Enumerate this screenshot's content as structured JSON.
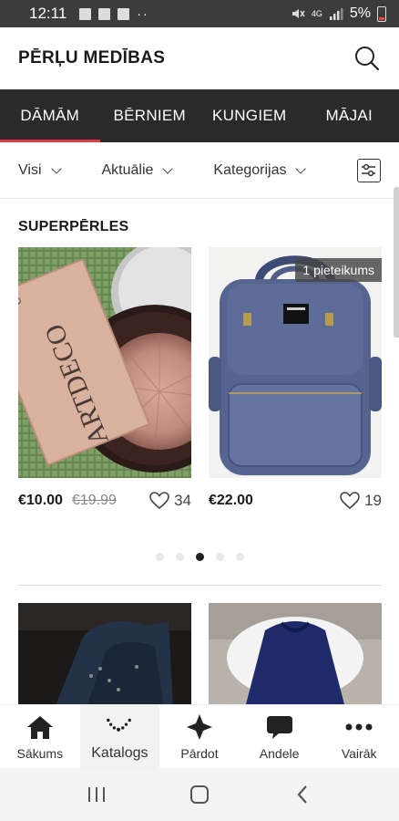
{
  "status_bar": {
    "time": "12:11",
    "dots": "··",
    "network": "4G",
    "battery": "5%"
  },
  "header": {
    "title": "PĒRĻU MEDĪBAS"
  },
  "category_tabs": [
    {
      "label": "DĀMĀM",
      "active": true
    },
    {
      "label": "BĒRNIEM",
      "active": false
    },
    {
      "label": "KUNGIEM",
      "active": false
    },
    {
      "label": "MĀJAI",
      "active": false
    }
  ],
  "filters": {
    "all": "Visi",
    "current": "Aktuālie",
    "categories": "Kategorijas"
  },
  "section": {
    "title": "SUPERPĒRLES"
  },
  "products": [
    {
      "price": "€10.00",
      "old_price": "€19.99",
      "likes": "34",
      "brand_text": "ARTDECO",
      "badge": ""
    },
    {
      "price": "€22.00",
      "old_price": "",
      "likes": "19",
      "badge": "1 pieteikums"
    }
  ],
  "pagination": {
    "total": 5,
    "active_index": 2
  },
  "bottom_nav": [
    {
      "label": "Sākums",
      "icon": "home-icon"
    },
    {
      "label": "Katalogs",
      "icon": "necklace-icon",
      "active": true
    },
    {
      "label": "Pārdot",
      "icon": "sparkle-icon"
    },
    {
      "label": "Andele",
      "icon": "chat-icon"
    },
    {
      "label": "Vairāk",
      "icon": "more-icon"
    }
  ],
  "colors": {
    "accent": "#e03c47",
    "tab_bar": "#2a2a2a",
    "status_bar": "#3c3c3c"
  }
}
